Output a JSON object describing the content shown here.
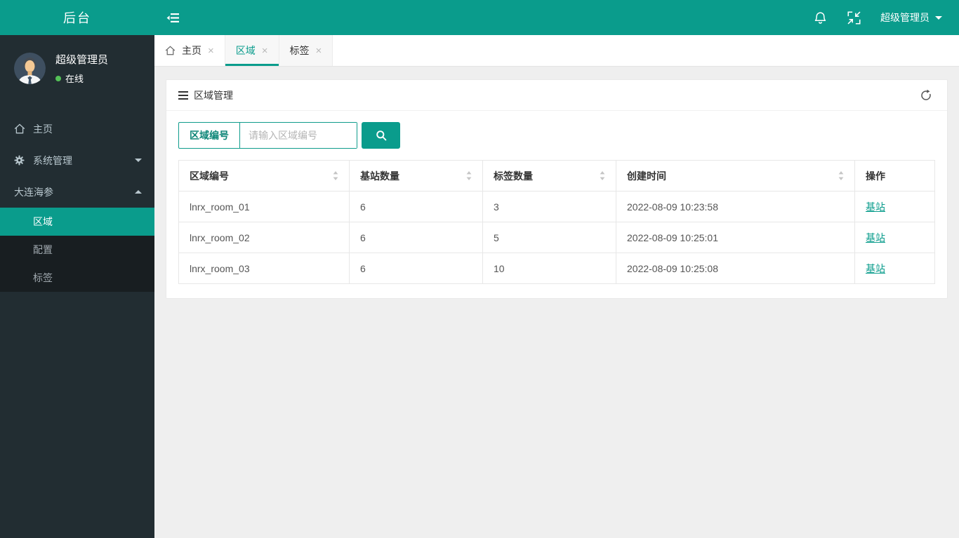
{
  "header": {
    "brand": "后台",
    "user_menu": "超级管理员"
  },
  "sidebar": {
    "user": {
      "name": "超级管理员",
      "status": "在线"
    },
    "menu": [
      {
        "label": "主页"
      },
      {
        "label": "系统管理"
      },
      {
        "label": "大连海参"
      }
    ],
    "submenu": [
      {
        "label": "区域"
      },
      {
        "label": "配置"
      },
      {
        "label": "标签"
      }
    ]
  },
  "tabs": [
    {
      "label": "主页"
    },
    {
      "label": "区域"
    },
    {
      "label": "标签"
    }
  ],
  "panel": {
    "title": "区域管理",
    "search": {
      "label": "区域编号",
      "placeholder": "请输入区域编号"
    },
    "table": {
      "headers": [
        "区域编号",
        "基站数量",
        "标签数量",
        "创建时间",
        "操作"
      ],
      "rows": [
        {
          "area": "lnrx_room_01",
          "stations": "6",
          "tags": "3",
          "created": "2022-08-09 10:23:58",
          "action": "基站"
        },
        {
          "area": "lnrx_room_02",
          "stations": "6",
          "tags": "5",
          "created": "2022-08-09 10:25:01",
          "action": "基站"
        },
        {
          "area": "lnrx_room_03",
          "stations": "6",
          "tags": "10",
          "created": "2022-08-09 10:25:08",
          "action": "基站"
        }
      ]
    }
  },
  "colors": {
    "primary": "#0a9c8c",
    "sidebar": "#222d32"
  }
}
